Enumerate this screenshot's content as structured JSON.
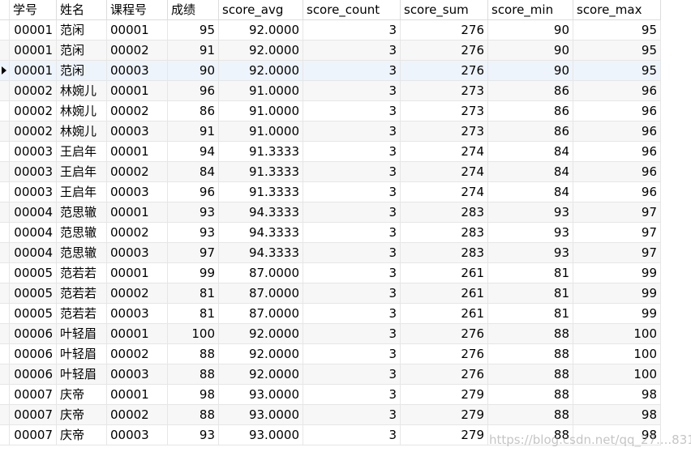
{
  "columns": [
    "学号",
    "姓名",
    "课程号",
    "成绩",
    "score_avg",
    "score_count",
    "score_sum",
    "score_min",
    "score_max"
  ],
  "selected_row": 2,
  "rows": [
    [
      "00001",
      "范闲",
      "00001",
      "95",
      "92.0000",
      "3",
      "276",
      "90",
      "95"
    ],
    [
      "00001",
      "范闲",
      "00002",
      "91",
      "92.0000",
      "3",
      "276",
      "90",
      "95"
    ],
    [
      "00001",
      "范闲",
      "00003",
      "90",
      "92.0000",
      "3",
      "276",
      "90",
      "95"
    ],
    [
      "00002",
      "林婉儿",
      "00001",
      "96",
      "91.0000",
      "3",
      "273",
      "86",
      "96"
    ],
    [
      "00002",
      "林婉儿",
      "00002",
      "86",
      "91.0000",
      "3",
      "273",
      "86",
      "96"
    ],
    [
      "00002",
      "林婉儿",
      "00003",
      "91",
      "91.0000",
      "3",
      "273",
      "86",
      "96"
    ],
    [
      "00003",
      "王启年",
      "00001",
      "94",
      "91.3333",
      "3",
      "274",
      "84",
      "96"
    ],
    [
      "00003",
      "王启年",
      "00002",
      "84",
      "91.3333",
      "3",
      "274",
      "84",
      "96"
    ],
    [
      "00003",
      "王启年",
      "00003",
      "96",
      "91.3333",
      "3",
      "274",
      "84",
      "96"
    ],
    [
      "00004",
      "范思辙",
      "00001",
      "93",
      "94.3333",
      "3",
      "283",
      "93",
      "97"
    ],
    [
      "00004",
      "范思辙",
      "00002",
      "93",
      "94.3333",
      "3",
      "283",
      "93",
      "97"
    ],
    [
      "00004",
      "范思辙",
      "00003",
      "97",
      "94.3333",
      "3",
      "283",
      "93",
      "97"
    ],
    [
      "00005",
      "范若若",
      "00001",
      "99",
      "87.0000",
      "3",
      "261",
      "81",
      "99"
    ],
    [
      "00005",
      "范若若",
      "00002",
      "81",
      "87.0000",
      "3",
      "261",
      "81",
      "99"
    ],
    [
      "00005",
      "范若若",
      "00003",
      "81",
      "87.0000",
      "3",
      "261",
      "81",
      "99"
    ],
    [
      "00006",
      "叶轻眉",
      "00001",
      "100",
      "92.0000",
      "3",
      "276",
      "88",
      "100"
    ],
    [
      "00006",
      "叶轻眉",
      "00002",
      "88",
      "92.0000",
      "3",
      "276",
      "88",
      "100"
    ],
    [
      "00006",
      "叶轻眉",
      "00003",
      "88",
      "92.0000",
      "3",
      "276",
      "88",
      "100"
    ],
    [
      "00007",
      "庆帝",
      "00001",
      "98",
      "93.0000",
      "3",
      "279",
      "88",
      "98"
    ],
    [
      "00007",
      "庆帝",
      "00002",
      "88",
      "93.0000",
      "3",
      "279",
      "88",
      "98"
    ],
    [
      "00007",
      "庆帝",
      "00003",
      "93",
      "93.0000",
      "3",
      "279",
      "88",
      "98"
    ]
  ],
  "watermark": "https://blog.csdn.net/qq_27....831"
}
